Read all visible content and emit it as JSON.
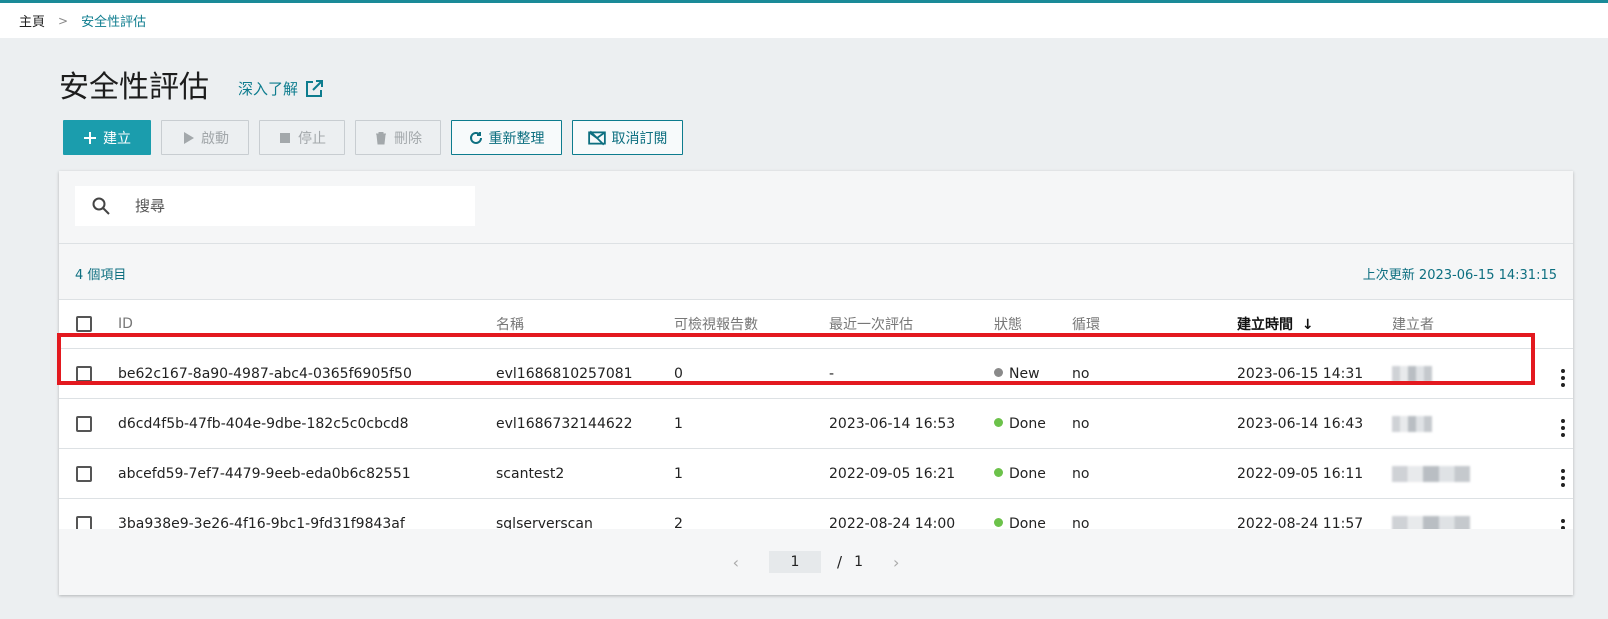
{
  "breadcrumb": {
    "home": "主頁",
    "separator": ">",
    "current": "安全性評估"
  },
  "page": {
    "title": "安全性評估",
    "learn_more": "深入了解"
  },
  "toolbar": {
    "create": "建立",
    "start": "啟動",
    "stop": "停止",
    "delete": "刪除",
    "refresh": "重新整理",
    "unsubscribe": "取消訂閱"
  },
  "search": {
    "placeholder": "搜尋"
  },
  "info": {
    "count": "4 個項目",
    "last_updated": "上次更新 2023-06-15 14:31:15"
  },
  "table": {
    "columns": {
      "id": "ID",
      "name": "名稱",
      "reports": "可檢視報告數",
      "last_eval": "最近一次評估",
      "status": "狀態",
      "recurring": "循環",
      "created": "建立時間",
      "creator": "建立者"
    },
    "sort_indicator": "↓",
    "rows": [
      {
        "id": "be62c167-8a90-4987-abc4-0365f6905f50",
        "name": "evl1686810257081",
        "reports": "0",
        "last_eval": "-",
        "status": "New",
        "status_color": "#8a8a8a",
        "recurring": "no",
        "created": "2023-06-15 14:31"
      },
      {
        "id": "d6cd4f5b-47fb-404e-9dbe-182c5c0cbcd8",
        "name": "evl1686732144622",
        "reports": "1",
        "last_eval": "2023-06-14 16:53",
        "status": "Done",
        "status_color": "#6cc24a",
        "recurring": "no",
        "created": "2023-06-14 16:43"
      },
      {
        "id": "abcefd59-7ef7-4479-9eeb-eda0b6c82551",
        "name": "scantest2",
        "reports": "1",
        "last_eval": "2022-09-05 16:21",
        "status": "Done",
        "status_color": "#6cc24a",
        "recurring": "no",
        "created": "2022-09-05 16:11"
      },
      {
        "id": "3ba938e9-3e26-4f16-9bc1-9fd31f9843af",
        "name": "sqlserverscan",
        "reports": "2",
        "last_eval": "2022-08-24 14:00",
        "status": "Done",
        "status_color": "#6cc24a",
        "recurring": "no",
        "created": "2022-08-24 11:57"
      }
    ]
  },
  "pager": {
    "prev": "‹",
    "current": "1",
    "separator": "/",
    "total": "1",
    "next": "›"
  },
  "colors": {
    "accent": "#1b9dad",
    "link": "#0d7c8e",
    "highlight": "#e3191f"
  }
}
